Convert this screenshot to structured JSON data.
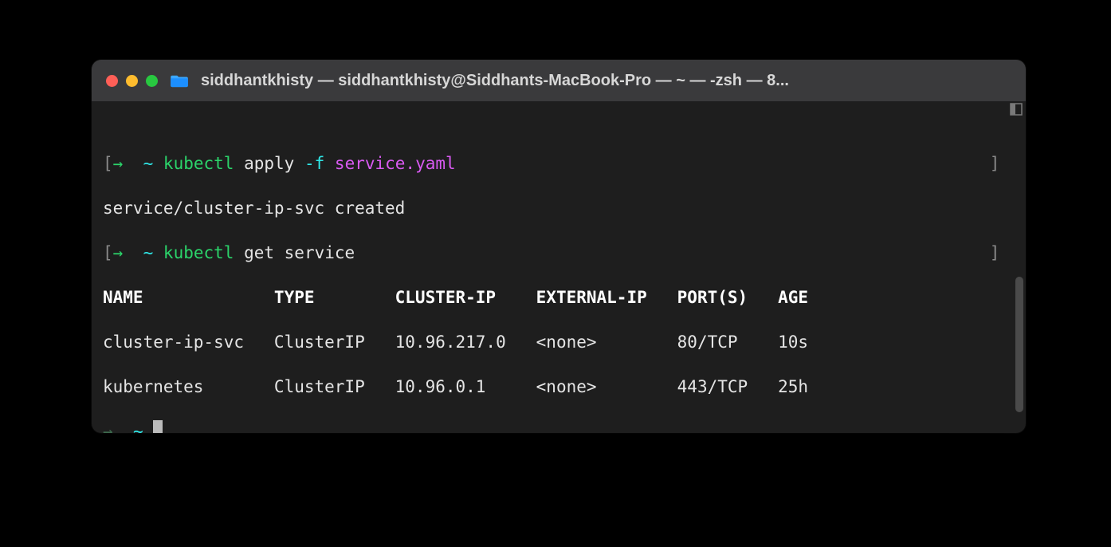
{
  "window": {
    "title": "siddhantkhisty — siddhantkhisty@Siddhants-MacBook-Pro — ~ — -zsh — 8..."
  },
  "prompts": {
    "arrow": "→",
    "tilde": "~",
    "left_bracket": "[",
    "right_bracket": "]"
  },
  "lines": {
    "line1": {
      "cmd": "kubectl",
      "sub": "apply",
      "flag": "-f",
      "arg": "service.yaml"
    },
    "line2": {
      "text": "service/cluster-ip-svc created"
    },
    "line3": {
      "cmd": "kubectl",
      "sub": "get service"
    }
  },
  "table": {
    "headers": {
      "name": "NAME",
      "type": "TYPE",
      "cluster_ip": "CLUSTER-IP",
      "external_ip": "EXTERNAL-IP",
      "ports": "PORT(S)",
      "age": "AGE"
    },
    "rows": [
      {
        "name": "cluster-ip-svc",
        "type": "ClusterIP",
        "cluster_ip": "10.96.217.0",
        "external_ip": "<none>",
        "ports": "80/TCP",
        "age": "10s"
      },
      {
        "name": "kubernetes",
        "type": "ClusterIP",
        "cluster_ip": "10.96.0.1",
        "external_ip": "<none>",
        "ports": "443/TCP",
        "age": "25h"
      }
    ]
  },
  "columns": {
    "name_w": 17,
    "type_w": 12,
    "cluster_ip_w": 14,
    "external_ip_w": 14,
    "ports_w": 10
  }
}
